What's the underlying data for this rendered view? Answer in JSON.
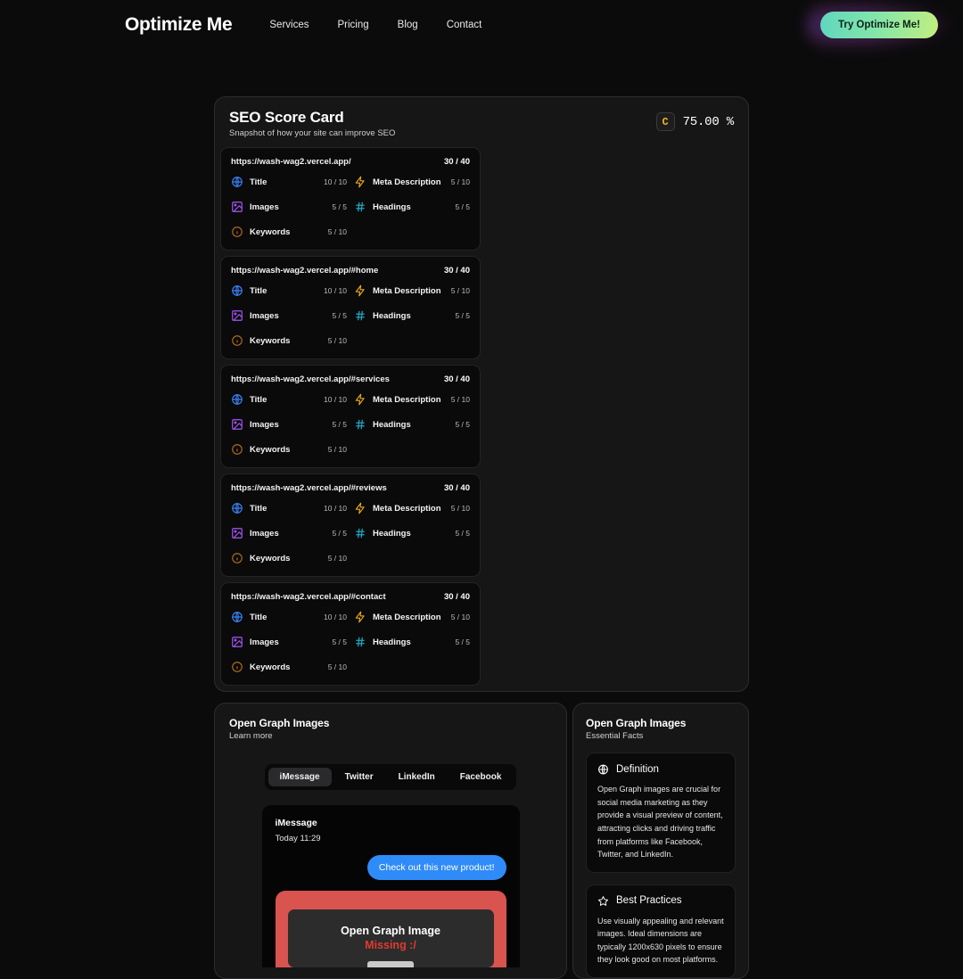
{
  "nav": {
    "brand": "Optimize Me",
    "links": [
      {
        "label": "Services"
      },
      {
        "label": "Pricing"
      },
      {
        "label": "Blog"
      },
      {
        "label": "Contact"
      }
    ],
    "cta_label": "Try Optimize Me!",
    "cta_gradient_from": "#5fd6c0",
    "cta_gradient_to": "#c3ef7e"
  },
  "score_card": {
    "title": "SEO Score Card",
    "subtitle": "Snapshot of how your site can improve SEO",
    "grade": "C",
    "grade_color": "#f0b429",
    "percent": "75.00 %",
    "metric_labels": {
      "title": "Title",
      "meta_description": "Meta Description",
      "images": "Images",
      "headings": "Headings",
      "keywords": "Keywords"
    },
    "metric_icons": {
      "title": "globe-icon",
      "meta_description": "zap-icon",
      "images": "image-icon",
      "headings": "hash-icon",
      "keywords": "info-circle-icon"
    },
    "metric_icon_colors": {
      "title": "#3b82f6",
      "meta_description": "#e9a820",
      "images": "#a855f7",
      "headings": "#22a8c4",
      "keywords": "#b06a1d"
    },
    "pages": [
      {
        "url": "https://wash-wag2.vercel.app/",
        "total": "30 / 40",
        "scores": {
          "title": "10 / 10",
          "meta_description": "5 / 10",
          "images": "5 / 5",
          "headings": "5 / 5",
          "keywords": "5 / 10"
        }
      },
      {
        "url": "https://wash-wag2.vercel.app/#home",
        "total": "30 / 40",
        "scores": {
          "title": "10 / 10",
          "meta_description": "5 / 10",
          "images": "5 / 5",
          "headings": "5 / 5",
          "keywords": "5 / 10"
        }
      },
      {
        "url": "https://wash-wag2.vercel.app/#services",
        "total": "30 / 40",
        "scores": {
          "title": "10 / 10",
          "meta_description": "5 / 10",
          "images": "5 / 5",
          "headings": "5 / 5",
          "keywords": "5 / 10"
        }
      },
      {
        "url": "https://wash-wag2.vercel.app/#reviews",
        "total": "30 / 40",
        "scores": {
          "title": "10 / 10",
          "meta_description": "5 / 10",
          "images": "5 / 5",
          "headings": "5 / 5",
          "keywords": "5 / 10"
        }
      },
      {
        "url": "https://wash-wag2.vercel.app/#contact",
        "total": "30 / 40",
        "scores": {
          "title": "10 / 10",
          "meta_description": "5 / 10",
          "images": "5 / 5",
          "headings": "5 / 5",
          "keywords": "5 / 10"
        }
      }
    ]
  },
  "og_main": {
    "title": "Open Graph Images",
    "subtitle": "Learn more",
    "tabs": [
      {
        "label": "iMessage",
        "active": true
      },
      {
        "label": "Twitter",
        "active": false
      },
      {
        "label": "LinkedIn",
        "active": false
      },
      {
        "label": "Facebook",
        "active": false
      }
    ],
    "preview": {
      "app": "iMessage",
      "time": "Today 11:29",
      "message": "Check out this new product!",
      "bubble_color": "#2f8bf7",
      "missing_title": "Open Graph Image",
      "missing_status": "Missing :/",
      "missing_bg": "#d9534f",
      "missing_status_color": "#e03b2f"
    }
  },
  "og_side": {
    "title": "Open Graph Images",
    "subtitle": "Essential Facts",
    "facts": [
      {
        "icon": "globe-icon",
        "heading": "Definition",
        "body": "Open Graph images are crucial for social media marketing as they provide a visual preview of content, attracting clicks and driving traffic from platforms like Facebook, Twitter, and LinkedIn."
      },
      {
        "icon": "star-icon",
        "heading": "Best Practices",
        "body": "Use visually appealing and relevant images. Ideal dimensions are typically 1200x630 pixels to ensure they look good on most platforms."
      }
    ]
  }
}
